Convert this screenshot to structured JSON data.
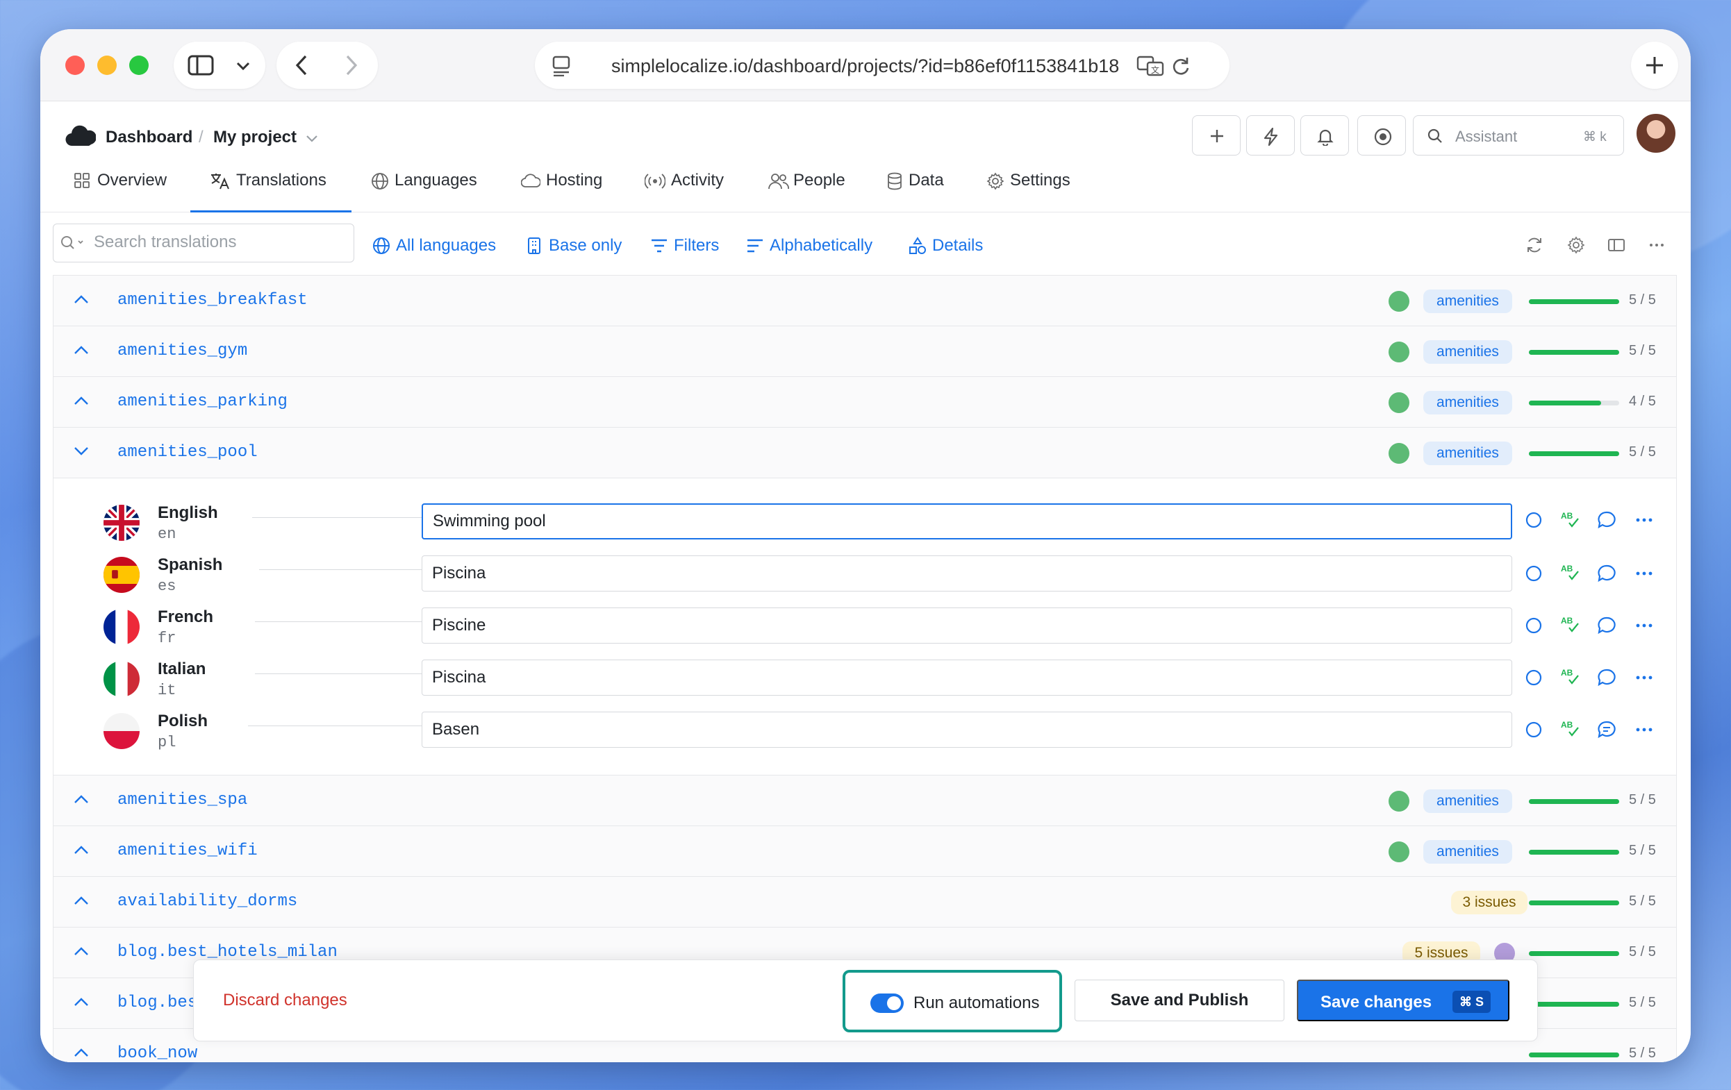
{
  "browser": {
    "url": "simplelocalize.io/dashboard/projects/?id=b86ef0f1153841b18"
  },
  "breadcrumb": {
    "root": "Dashboard",
    "separator": "/",
    "project": "My project"
  },
  "header": {
    "assistant_placeholder": "Assistant",
    "assistant_shortcut": "⌘ k"
  },
  "tabs": [
    {
      "label": "Overview",
      "icon": "grid-icon"
    },
    {
      "label": "Translations",
      "icon": "translate-icon",
      "active": true
    },
    {
      "label": "Languages",
      "icon": "globe-icon"
    },
    {
      "label": "Hosting",
      "icon": "cloud-icon"
    },
    {
      "label": "Activity",
      "icon": "broadcast-icon"
    },
    {
      "label": "People",
      "icon": "people-icon"
    },
    {
      "label": "Data",
      "icon": "database-icon"
    },
    {
      "label": "Settings",
      "icon": "gear-icon"
    }
  ],
  "filters": {
    "search_placeholder": "Search translations",
    "all_languages": "All languages",
    "base_only": "Base only",
    "filters": "Filters",
    "sort": "Alphabetically",
    "details": "Details"
  },
  "keys": [
    {
      "key": "amenities_breakfast",
      "tag": "amenities",
      "progress": 1.0,
      "count": "5 / 5"
    },
    {
      "key": "amenities_gym",
      "tag": "amenities",
      "progress": 1.0,
      "count": "5 / 5"
    },
    {
      "key": "amenities_parking",
      "tag": "amenities",
      "progress": 0.8,
      "count": "4 / 5"
    },
    {
      "key": "amenities_pool",
      "tag": "amenities",
      "progress": 1.0,
      "count": "5 / 5",
      "expanded": true
    },
    {
      "key": "amenities_spa",
      "tag": "amenities",
      "progress": 1.0,
      "count": "5 / 5"
    },
    {
      "key": "amenities_wifi",
      "tag": "amenities",
      "progress": 1.0,
      "count": "5 / 5"
    },
    {
      "key": "availability_dorms",
      "issues": "3 issues",
      "progress": 1.0,
      "count": "5 / 5"
    },
    {
      "key": "blog.best_hotels_milan",
      "issues": "5 issues",
      "progress": 1.0,
      "count": "5 / 5"
    },
    {
      "key": "blog.bes",
      "progress": 1.0,
      "count": "5 / 5"
    },
    {
      "key": "book_now",
      "progress": 1.0,
      "count": "5 / 5"
    }
  ],
  "translations": [
    {
      "language": "English",
      "code": "en",
      "value": "Swimming pool"
    },
    {
      "language": "Spanish",
      "code": "es",
      "value": "Piscina"
    },
    {
      "language": "French",
      "code": "fr",
      "value": "Piscine"
    },
    {
      "language": "Italian",
      "code": "it",
      "value": "Piscina"
    },
    {
      "language": "Polish",
      "code": "pl",
      "value": "Basen"
    }
  ],
  "savebar": {
    "discard": "Discard changes",
    "run_automations": "Run automations",
    "run_automations_enabled": true,
    "save_publish": "Save and Publish",
    "save": "Save changes",
    "save_shortcut": "⌘ S"
  },
  "colors": {
    "accent": "#1a73e8",
    "success": "#1fb552",
    "danger": "#d0332c",
    "highlight": "#139a8c"
  }
}
